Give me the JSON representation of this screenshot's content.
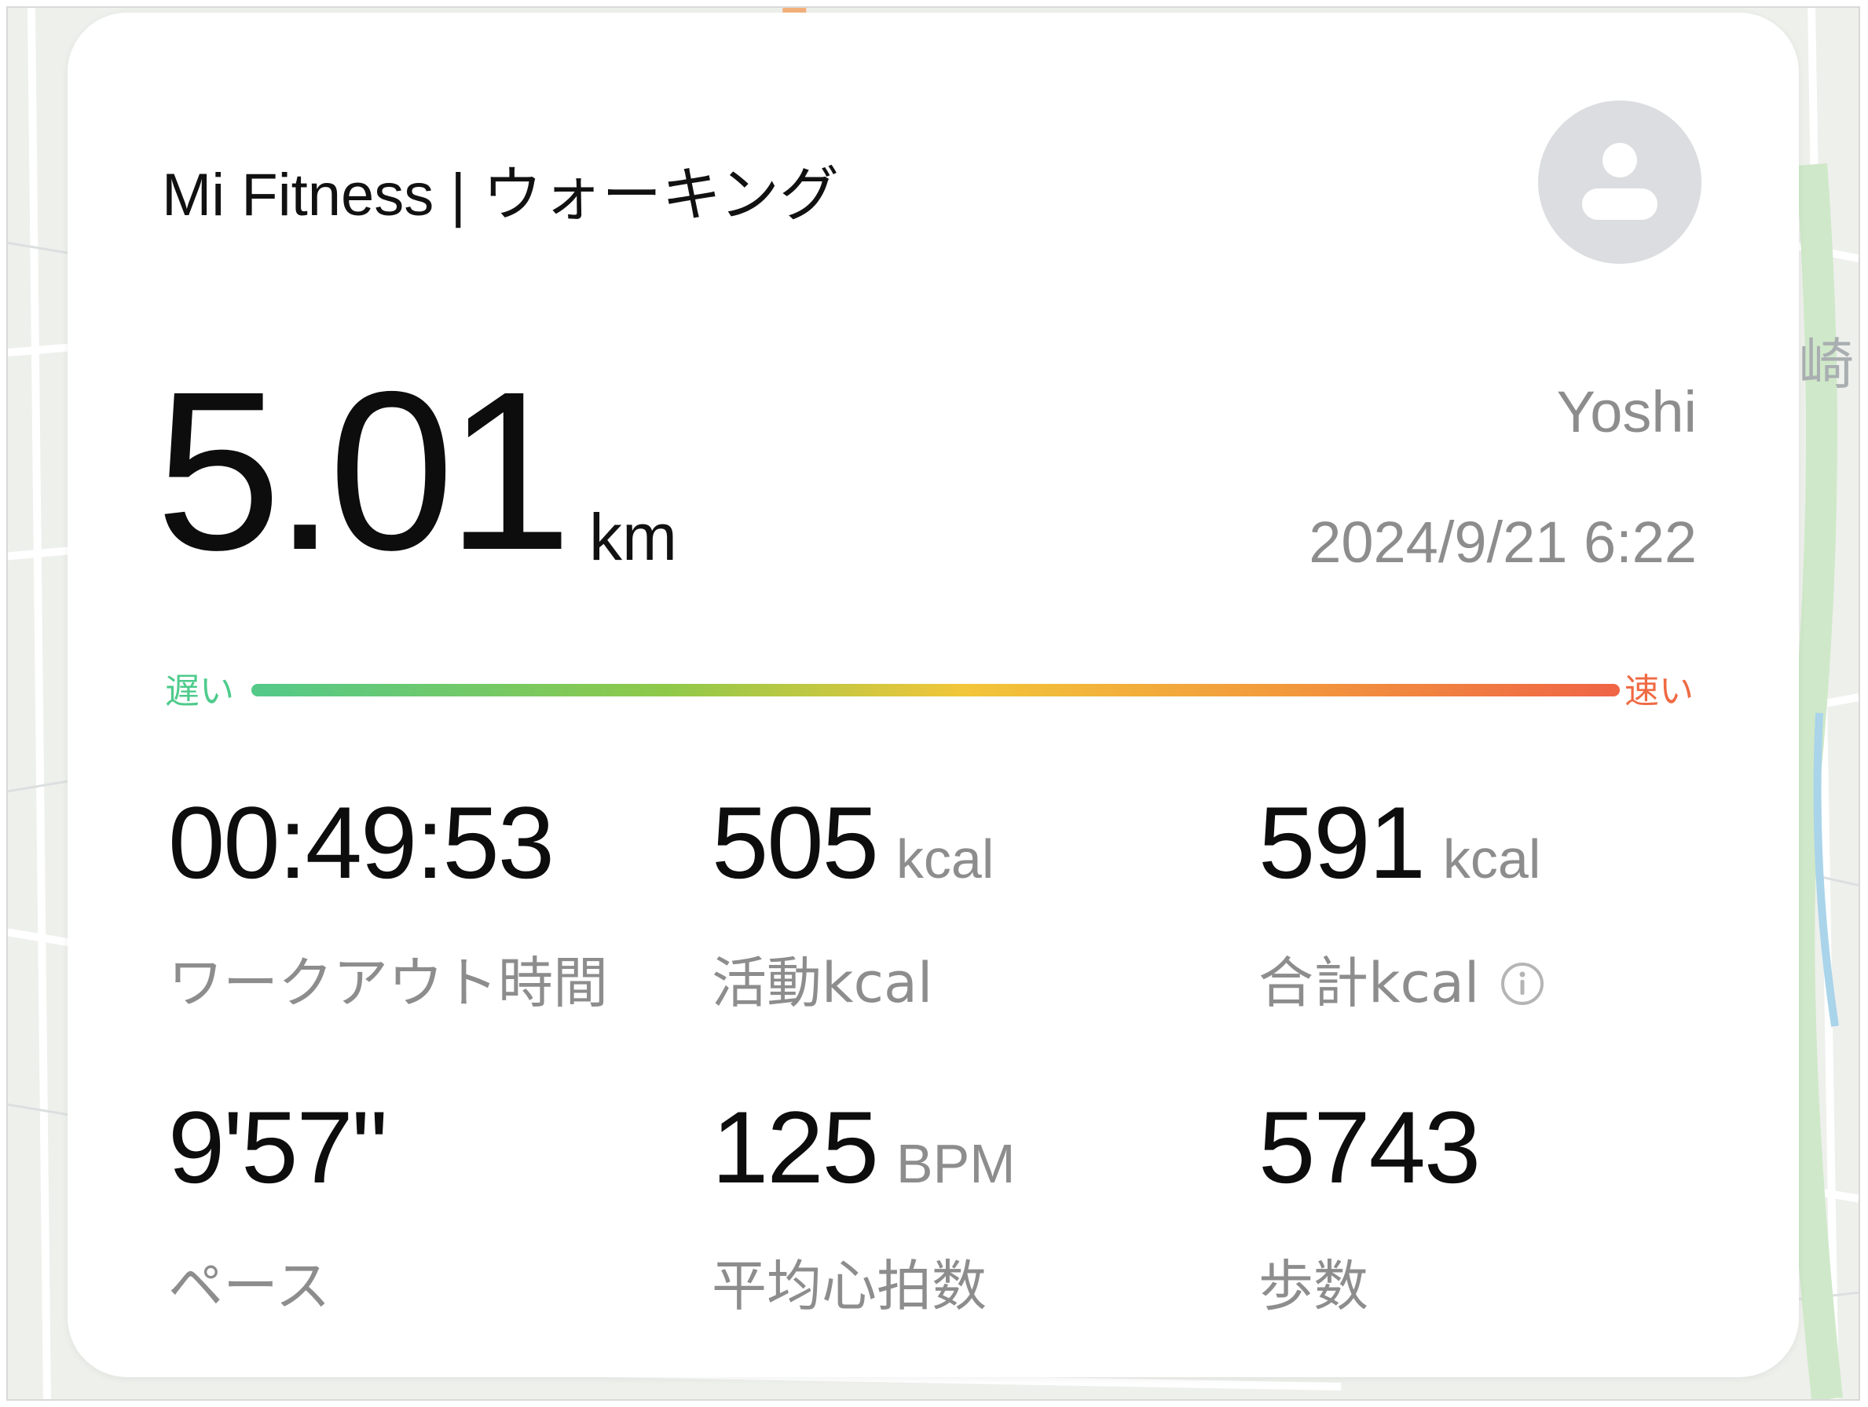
{
  "map": {
    "label_char": "崎"
  },
  "card": {
    "app_title": "Mi Fitness | ウォーキング",
    "avatar_icon": "user-avatar-icon",
    "distance": {
      "value": "5.01",
      "unit": "km"
    },
    "user_name": "Yoshi",
    "datetime": "2024/9/21 6:22",
    "pace_scale": {
      "slow_label": "遅い",
      "fast_label": "速い",
      "colors": [
        "#53c98a",
        "#f2c63a",
        "#ef6446"
      ]
    },
    "stats": {
      "workout_time": {
        "value": "00:49:53",
        "label": "ワークアウト時間"
      },
      "active_kcal": {
        "value": "505",
        "unit": "kcal",
        "label": "活動kcal"
      },
      "total_kcal": {
        "value": "591",
        "unit": "kcal",
        "label": "合計kcal",
        "info_icon": "info-circle-icon"
      },
      "pace": {
        "value": "9'57\"",
        "label": "ペース"
      },
      "avg_heart_rate": {
        "value": "125",
        "unit": "BPM",
        "label": "平均心拍数"
      },
      "steps": {
        "value": "5743",
        "label": "歩数"
      }
    }
  }
}
